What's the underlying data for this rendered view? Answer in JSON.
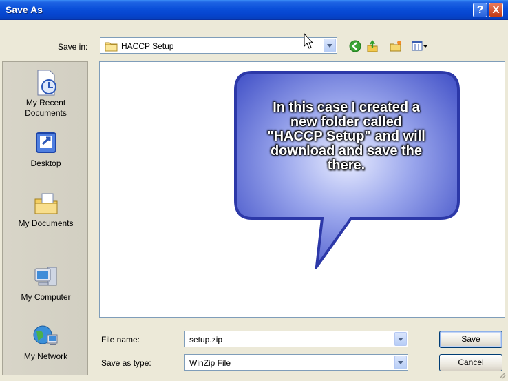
{
  "window": {
    "title": "Save As",
    "help_glyph": "?",
    "close_glyph": "X"
  },
  "toolbar": {
    "save_in_label": "Save in:",
    "save_in_value": "HACCP Setup",
    "icons": [
      "back-icon",
      "up-folder-icon",
      "new-folder-icon",
      "views-menu-icon"
    ]
  },
  "places": {
    "items": [
      {
        "label_line1": "My Recent",
        "label_line2": "Documents",
        "icon": "recent-documents-icon"
      },
      {
        "label_line1": "Desktop",
        "label_line2": "",
        "icon": "desktop-icon"
      },
      {
        "label_line1": "My Documents",
        "label_line2": "",
        "icon": "my-documents-icon"
      },
      {
        "label_line1": "My Computer",
        "label_line2": "",
        "icon": "my-computer-icon"
      },
      {
        "label_line1": "My Network",
        "label_line2": "",
        "icon": "my-network-icon"
      }
    ]
  },
  "callout": {
    "line1": "In this case I created a",
    "line2": "new folder called",
    "line3": "\"HACCP Setup\" and will",
    "line4": "download and save the",
    "line5": "there."
  },
  "form": {
    "file_name_label": "File name:",
    "file_name_value": "setup.zip",
    "save_type_label": "Save as type:",
    "save_type_value": "WinZip File",
    "save_button": "Save",
    "cancel_button": "Cancel"
  },
  "colors": {
    "titlebar": "#0a4fd9",
    "dialog_bg": "#ece9d8",
    "callout_fill": "#6a78d8",
    "field_border": "#7f9db9"
  }
}
